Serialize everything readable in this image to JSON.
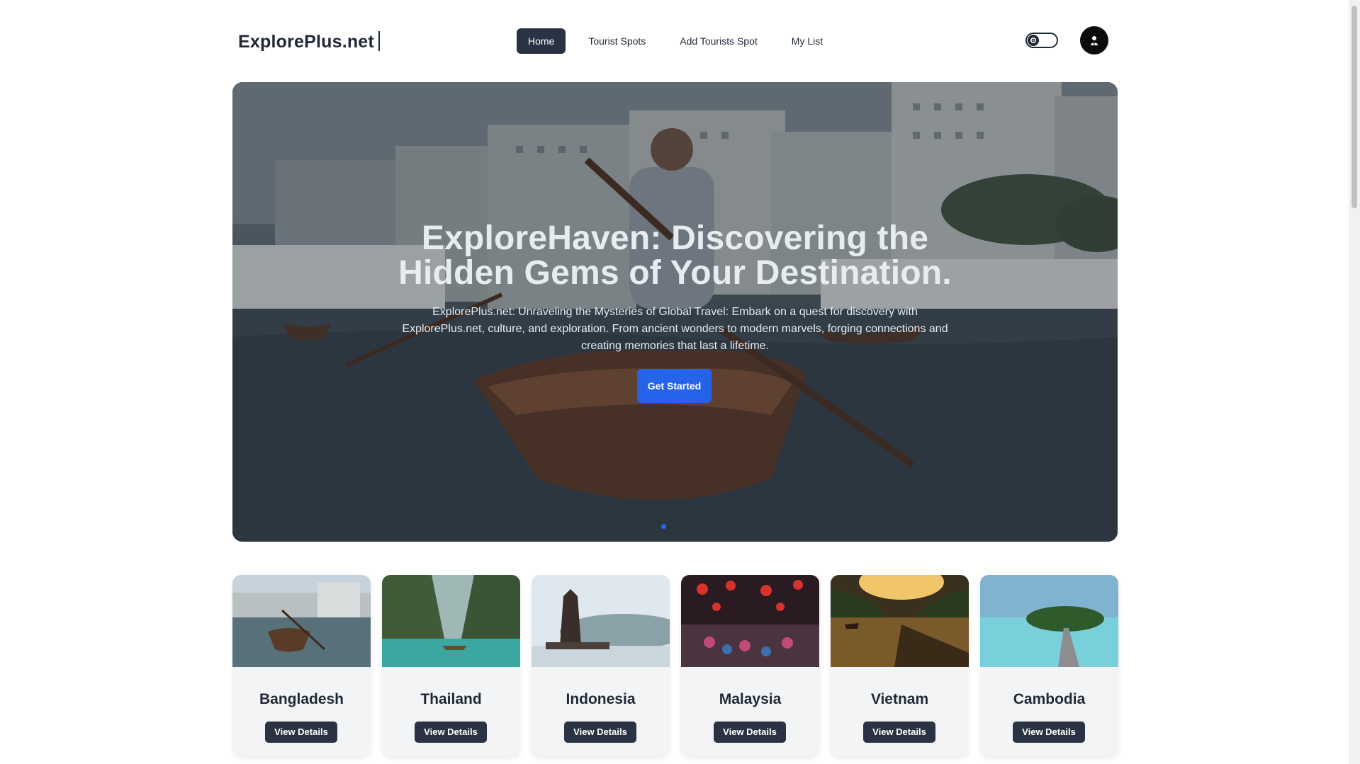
{
  "brand": {
    "name": "ExplorePlus.net"
  },
  "nav": {
    "items": [
      {
        "label": "Home",
        "active": true
      },
      {
        "label": "Tourist Spots",
        "active": false
      },
      {
        "label": "Add Tourists Spot",
        "active": false
      },
      {
        "label": "My List",
        "active": false
      }
    ]
  },
  "header": {
    "theme_toggle_icon": "gear-icon",
    "avatar_icon": "user-icon"
  },
  "hero": {
    "title_line1": "ExploreHaven: Discovering the",
    "title_line2": "Hidden Gems of Your Destination.",
    "description": "ExplorePlus.net: Unraveling the Mysteries of Global Travel: Embark on a quest for discovery with ExplorePlus.net, culture, and exploration. From ancient wonders to modern marvels, forging connections and creating memories that last a lifetime.",
    "cta_label": "Get Started"
  },
  "countries": [
    {
      "name": "Bangladesh",
      "button": "View Details"
    },
    {
      "name": "Thailand",
      "button": "View Details"
    },
    {
      "name": "Indonesia",
      "button": "View Details"
    },
    {
      "name": "Malaysia",
      "button": "View Details"
    },
    {
      "name": "Vietnam",
      "button": "View Details"
    },
    {
      "name": "Cambodia",
      "button": "View Details"
    }
  ],
  "colors": {
    "primary_dark": "#2a3344",
    "accent_blue": "#2563eb"
  }
}
